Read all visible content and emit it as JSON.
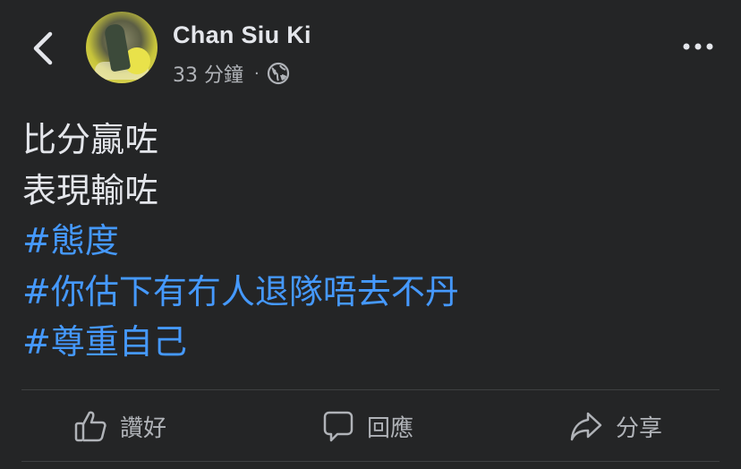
{
  "header": {
    "back_icon": "chevron-left-icon",
    "user_name": "Chan Siu Ki",
    "timestamp": "33 分鐘",
    "separator": "·",
    "privacy_icon": "globe-icon",
    "more_icon": "more-dots-icon"
  },
  "post": {
    "lines": [
      "比分贏咗",
      "表現輸咗"
    ],
    "hashtags": [
      "#態度",
      "#你估下有冇人退隊唔去不丹",
      "#尊重自己"
    ]
  },
  "actions": {
    "like_label": "讚好",
    "comment_label": "回應",
    "share_label": "分享"
  },
  "colors": {
    "background": "#242526",
    "text": "#e4e6eb",
    "secondary": "#b0b3b8",
    "hashtag": "#4599ff",
    "divider": "#3e4042"
  }
}
